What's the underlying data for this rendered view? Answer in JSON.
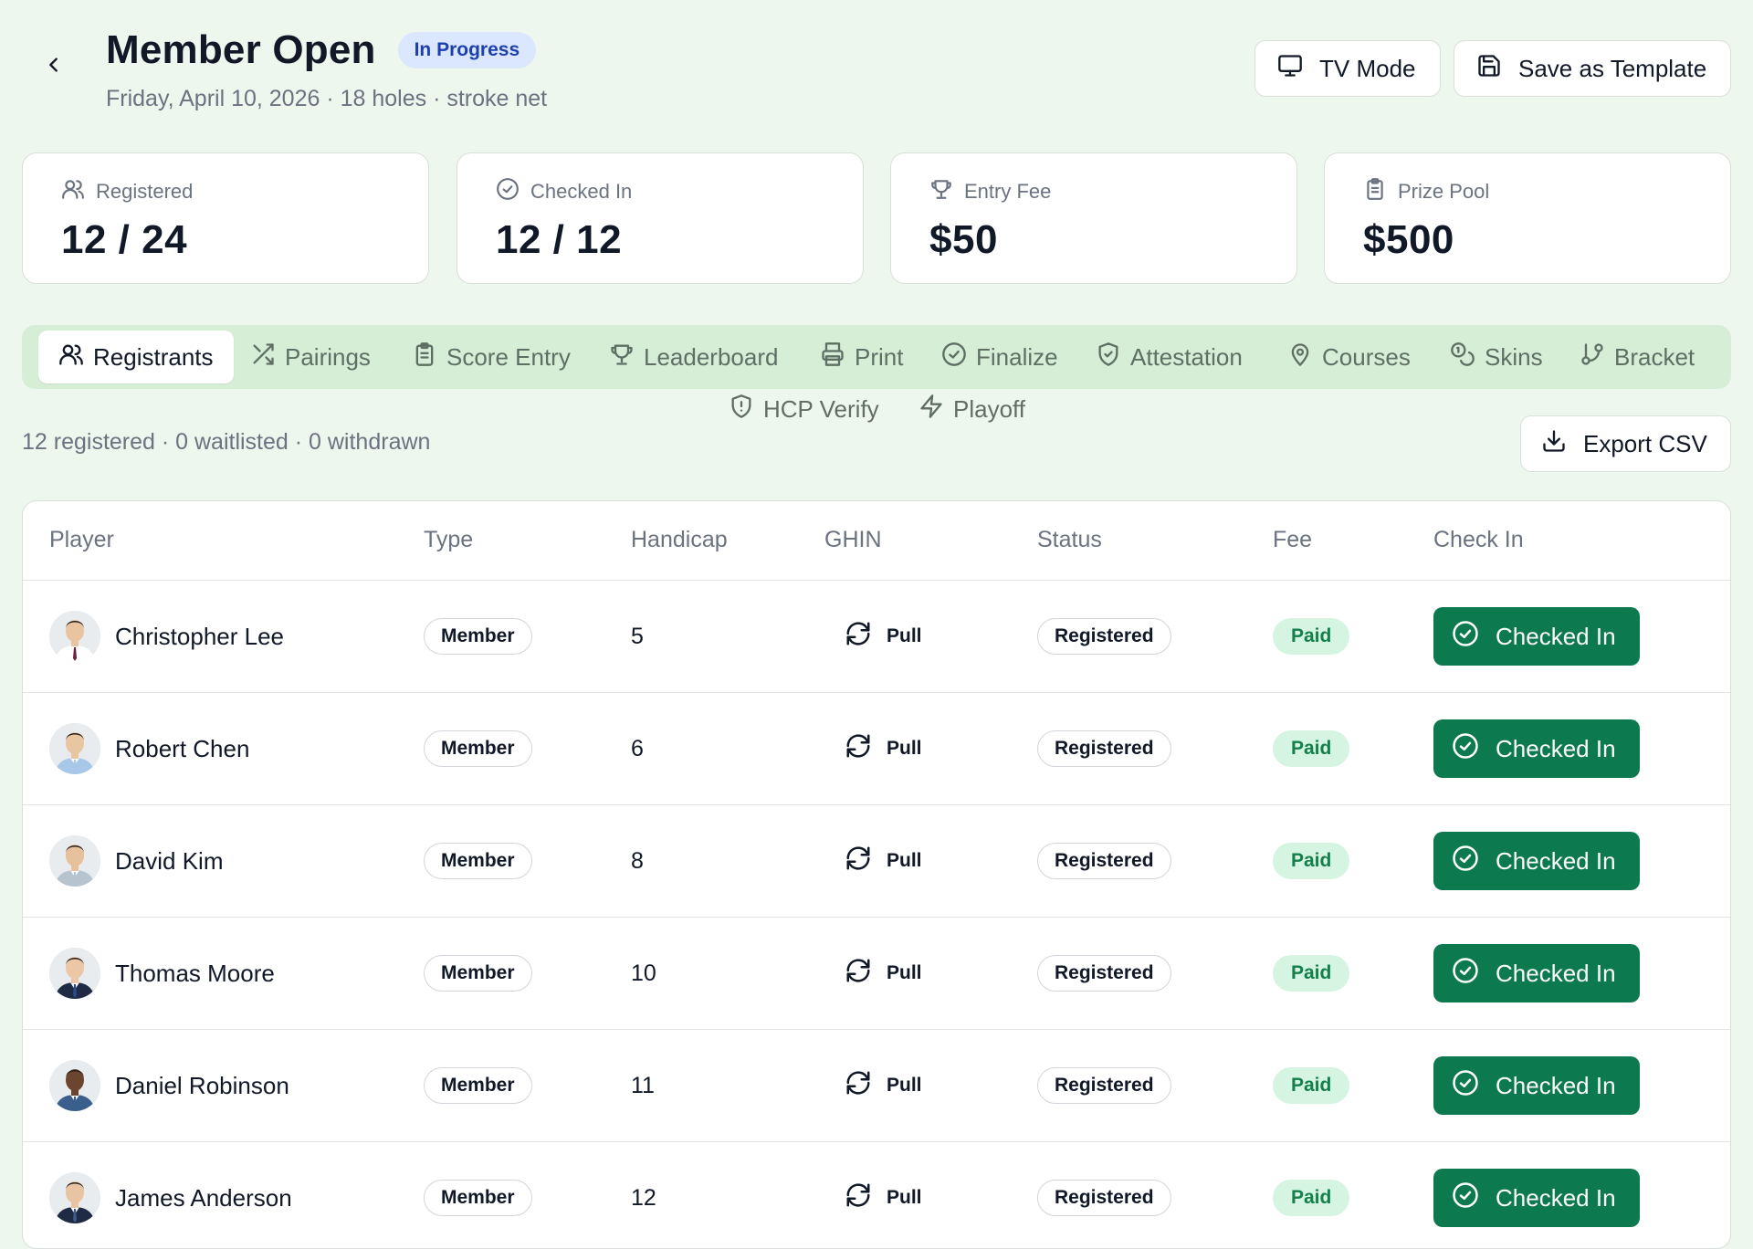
{
  "header": {
    "title": "Member Open",
    "status": "In Progress",
    "subtitle": "Friday, April 10, 2026 · 18 holes · stroke net",
    "back_icon": "chevron-left-icon",
    "tv_mode_label": "TV Mode",
    "save_template_label": "Save as Template"
  },
  "stats": [
    {
      "label": "Registered",
      "value": "12 / 24",
      "icon": "users-icon"
    },
    {
      "label": "Checked In",
      "value": "12 / 12",
      "icon": "check-circle-icon"
    },
    {
      "label": "Entry Fee",
      "value": "$50",
      "icon": "trophy-icon"
    },
    {
      "label": "Prize Pool",
      "value": "$500",
      "icon": "clipboard-icon"
    }
  ],
  "tabs": [
    {
      "label": "Registrants",
      "icon": "users-icon",
      "active": true
    },
    {
      "label": "Pairings",
      "icon": "shuffle-icon"
    },
    {
      "label": "Score Entry",
      "icon": "clipboard-icon"
    },
    {
      "label": "Leaderboard",
      "icon": "trophy-icon"
    },
    {
      "label": "Print",
      "icon": "printer-icon"
    },
    {
      "label": "Finalize",
      "icon": "check-circle-icon"
    },
    {
      "label": "Attestation",
      "icon": "shield-check-icon"
    },
    {
      "label": "Courses",
      "icon": "map-pin-icon"
    },
    {
      "label": "Skins",
      "icon": "coins-icon"
    },
    {
      "label": "Bracket",
      "icon": "git-branch-icon"
    },
    {
      "label": "HCP Verify",
      "icon": "shield-alert-icon"
    },
    {
      "label": "Playoff",
      "icon": "zap-icon"
    }
  ],
  "summary": "12 registered · 0 waitlisted · 0 withdrawn",
  "export_label": "Export CSV",
  "table": {
    "columns": [
      "Player",
      "Type",
      "Handicap",
      "GHIN",
      "Status",
      "Fee",
      "Check In"
    ],
    "rows": [
      {
        "name": "Christopher Lee",
        "type": "Member",
        "handicap": "5",
        "ghin": "Pull",
        "status": "Registered",
        "fee": "Paid",
        "checkin": "Checked In",
        "skin": "#e8c4a0",
        "suit": "#ffffff",
        "tie": "#6b2142"
      },
      {
        "name": "Robert Chen",
        "type": "Member",
        "handicap": "6",
        "ghin": "Pull",
        "status": "Registered",
        "fee": "Paid",
        "checkin": "Checked In",
        "skin": "#e9c6a2",
        "suit": "#a7c8e8",
        "tie": "#a7c8e8"
      },
      {
        "name": "David Kim",
        "type": "Member",
        "handicap": "8",
        "ghin": "Pull",
        "status": "Registered",
        "fee": "Paid",
        "checkin": "Checked In",
        "skin": "#e6c19c",
        "suit": "#b7c3cf",
        "tie": "#b7c3cf"
      },
      {
        "name": "Thomas Moore",
        "type": "Member",
        "handicap": "10",
        "ghin": "Pull",
        "status": "Registered",
        "fee": "Paid",
        "checkin": "Checked In",
        "skin": "#ecc7a6",
        "suit": "#1f2a44",
        "tie": "#2b4a8b"
      },
      {
        "name": "Daniel Robinson",
        "type": "Member",
        "handicap": "11",
        "ghin": "Pull",
        "status": "Registered",
        "fee": "Paid",
        "checkin": "Checked In",
        "skin": "#6b4530",
        "suit": "#3b5f8c",
        "tie": "#3b5f8c"
      },
      {
        "name": "James Anderson",
        "type": "Member",
        "handicap": "12",
        "ghin": "Pull",
        "status": "Registered",
        "fee": "Paid",
        "checkin": "Checked In",
        "skin": "#e8c4a2",
        "suit": "#1f2a44",
        "tie": "#3d5a8a"
      }
    ]
  },
  "colors": {
    "background": "#eef7ee",
    "tabbar": "#d6eed6",
    "primary_green": "#0c7a4e",
    "paid_bg": "#d5f4e2",
    "status_pill_bg": "#dbe7ff"
  }
}
